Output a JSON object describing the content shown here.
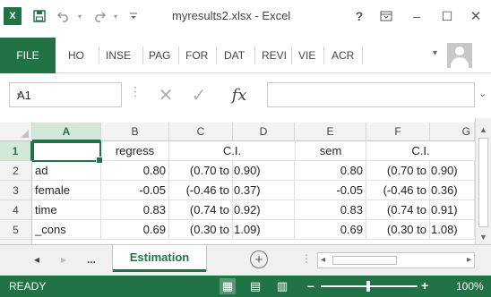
{
  "titlebar": {
    "logo_text": "x⃣",
    "logo_label": "X",
    "save_icon": "save-icon",
    "undo_icon": "undo-icon",
    "redo_icon": "redo-icon",
    "customize_icon": "customize-qat-icon",
    "title": "myresults2.xlsx - Excel",
    "help": "?",
    "ribbon_display_icon": "ribbon-display-options-icon",
    "minimize": "–",
    "restore": "☐",
    "close": "✕"
  },
  "ribbon": {
    "tabs": [
      "FILE",
      "HO",
      "INSE",
      "PAG",
      "FOR",
      "DAT",
      "REVI",
      "VIE",
      "ACR"
    ],
    "collapse_icon": "▾"
  },
  "formula_bar": {
    "name_box_value": "A1",
    "name_box_dropdown": "▾",
    "dots": "⋮",
    "cancel_glyph": "✕",
    "enter_glyph": "✓",
    "fx_label": "fx",
    "formula_value": "",
    "expand_glyph": "⌄"
  },
  "sheet": {
    "columns": [
      "A",
      "B",
      "C",
      "D",
      "E",
      "F",
      "G"
    ],
    "active_column": "A",
    "active_row": "1",
    "rows": [
      {
        "num": "1",
        "a": "",
        "b": "regress",
        "cd": "C.I.",
        "e": "sem",
        "fg": "C.I."
      },
      {
        "num": "2",
        "a": "ad",
        "b": "0.80",
        "c": "(0.70 to",
        "d": "0.90)",
        "e": "0.80",
        "f": "(0.70 to",
        "g": "0.90)"
      },
      {
        "num": "3",
        "a": "female",
        "b": "-0.05",
        "c": "(-0.46 to",
        "d": "0.37)",
        "e": "-0.05",
        "f": "(-0.46 to",
        "g": "0.36)"
      },
      {
        "num": "4",
        "a": "time",
        "b": "0.83",
        "c": "(0.74 to",
        "d": "0.92)",
        "e": "0.83",
        "f": "(0.74 to",
        "g": "0.91)"
      },
      {
        "num": "5",
        "a": "_cons",
        "b": "0.69",
        "c": "(0.30 to",
        "d": "1.09)",
        "e": "0.69",
        "f": "(0.30 to",
        "g": "1.08)"
      }
    ]
  },
  "sheet_tabs": {
    "prev": "◂",
    "next": "▸",
    "more": "...",
    "active_tab": "Estimation",
    "add": "+",
    "dots": "⋮",
    "scroll_left": "◂",
    "scroll_right": "▸"
  },
  "statusbar": {
    "status": "READY",
    "view_normal": "▦",
    "view_layout": "▤",
    "view_break": "▥",
    "zoom_minus": "–",
    "zoom_plus": "+",
    "zoom": "100%"
  },
  "colors": {
    "accent": "#217346",
    "header_active": "#d3e8d9"
  }
}
